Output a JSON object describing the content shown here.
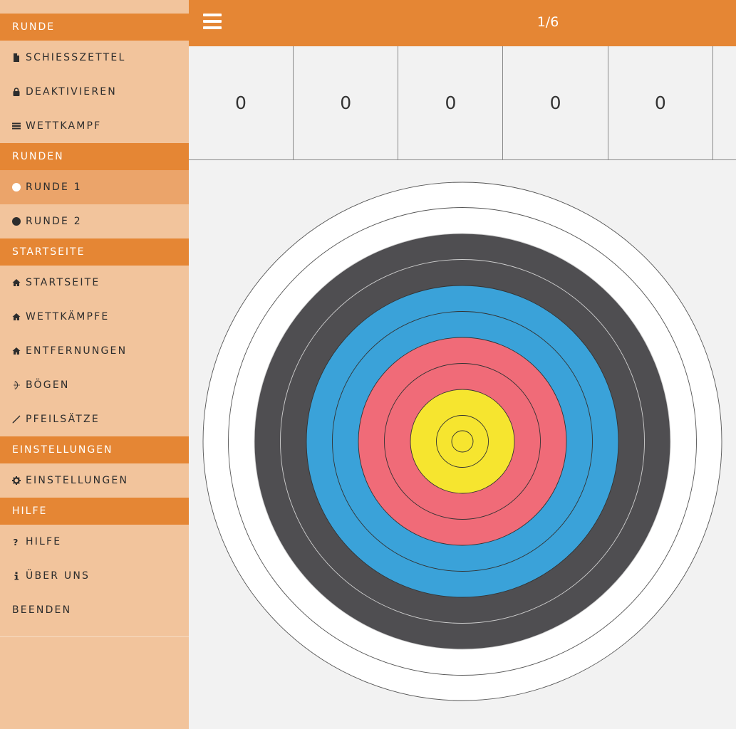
{
  "sidebar": {
    "sections": [
      {
        "header": "RUNDE",
        "items": [
          {
            "label": "SCHIESSZETTEL",
            "icon": "document-icon",
            "name": "sidebar-item-schiesszettel"
          },
          {
            "label": "DEAKTIVIEREN",
            "icon": "lock-icon",
            "name": "sidebar-item-deaktivieren"
          },
          {
            "label": "WETTKAMPF",
            "icon": "list-icon",
            "name": "sidebar-item-wettkampf"
          }
        ]
      },
      {
        "header": "RUNDEN",
        "items": [
          {
            "label": "RUNDE 1",
            "icon": "circle-white-icon",
            "name": "sidebar-item-runde-1",
            "active": true
          },
          {
            "label": "RUNDE 2",
            "icon": "circle-black-icon",
            "name": "sidebar-item-runde-2"
          }
        ]
      },
      {
        "header": "STARTSEITE",
        "items": [
          {
            "label": "STARTSEITE",
            "icon": "home-icon",
            "name": "sidebar-item-startseite"
          },
          {
            "label": "WETTKÄMPFE",
            "icon": "home-icon",
            "name": "sidebar-item-wettkaempfe"
          },
          {
            "label": "ENTFERNUNGEN",
            "icon": "home-icon",
            "name": "sidebar-item-entfernungen"
          },
          {
            "label": "BÖGEN",
            "icon": "bow-icon",
            "name": "sidebar-item-boegen"
          },
          {
            "label": "PFEILSÄTZE",
            "icon": "arrow-icon",
            "name": "sidebar-item-pfeilsaetze"
          }
        ]
      },
      {
        "header": "EINSTELLUNGEN",
        "items": [
          {
            "label": "EINSTELLUNGEN",
            "icon": "gear-icon",
            "name": "sidebar-item-einstellungen"
          }
        ]
      },
      {
        "header": "HILFE",
        "items": [
          {
            "label": "HILFE",
            "icon": "question-icon",
            "name": "sidebar-item-hilfe"
          },
          {
            "label": "ÜBER UNS",
            "icon": "info-icon",
            "name": "sidebar-item-ueber-uns"
          },
          {
            "label": "BEENDEN",
            "icon": "",
            "name": "sidebar-item-beenden"
          }
        ]
      }
    ]
  },
  "topbar": {
    "menu_icon": "hamburger-menu-icon",
    "round_counter": "1/6"
  },
  "scores": [
    "0",
    "0",
    "0",
    "0",
    "0"
  ],
  "target": {
    "colors": {
      "white": "#ffffff",
      "black": "#4f4e51",
      "blue": "#3aa2d9",
      "red": "#f06b78",
      "gold": "#f6e52f"
    }
  },
  "theme": {
    "accent": "#e58634",
    "sidebar_bg": "#f2c49c",
    "active_item": "#eba46a"
  }
}
